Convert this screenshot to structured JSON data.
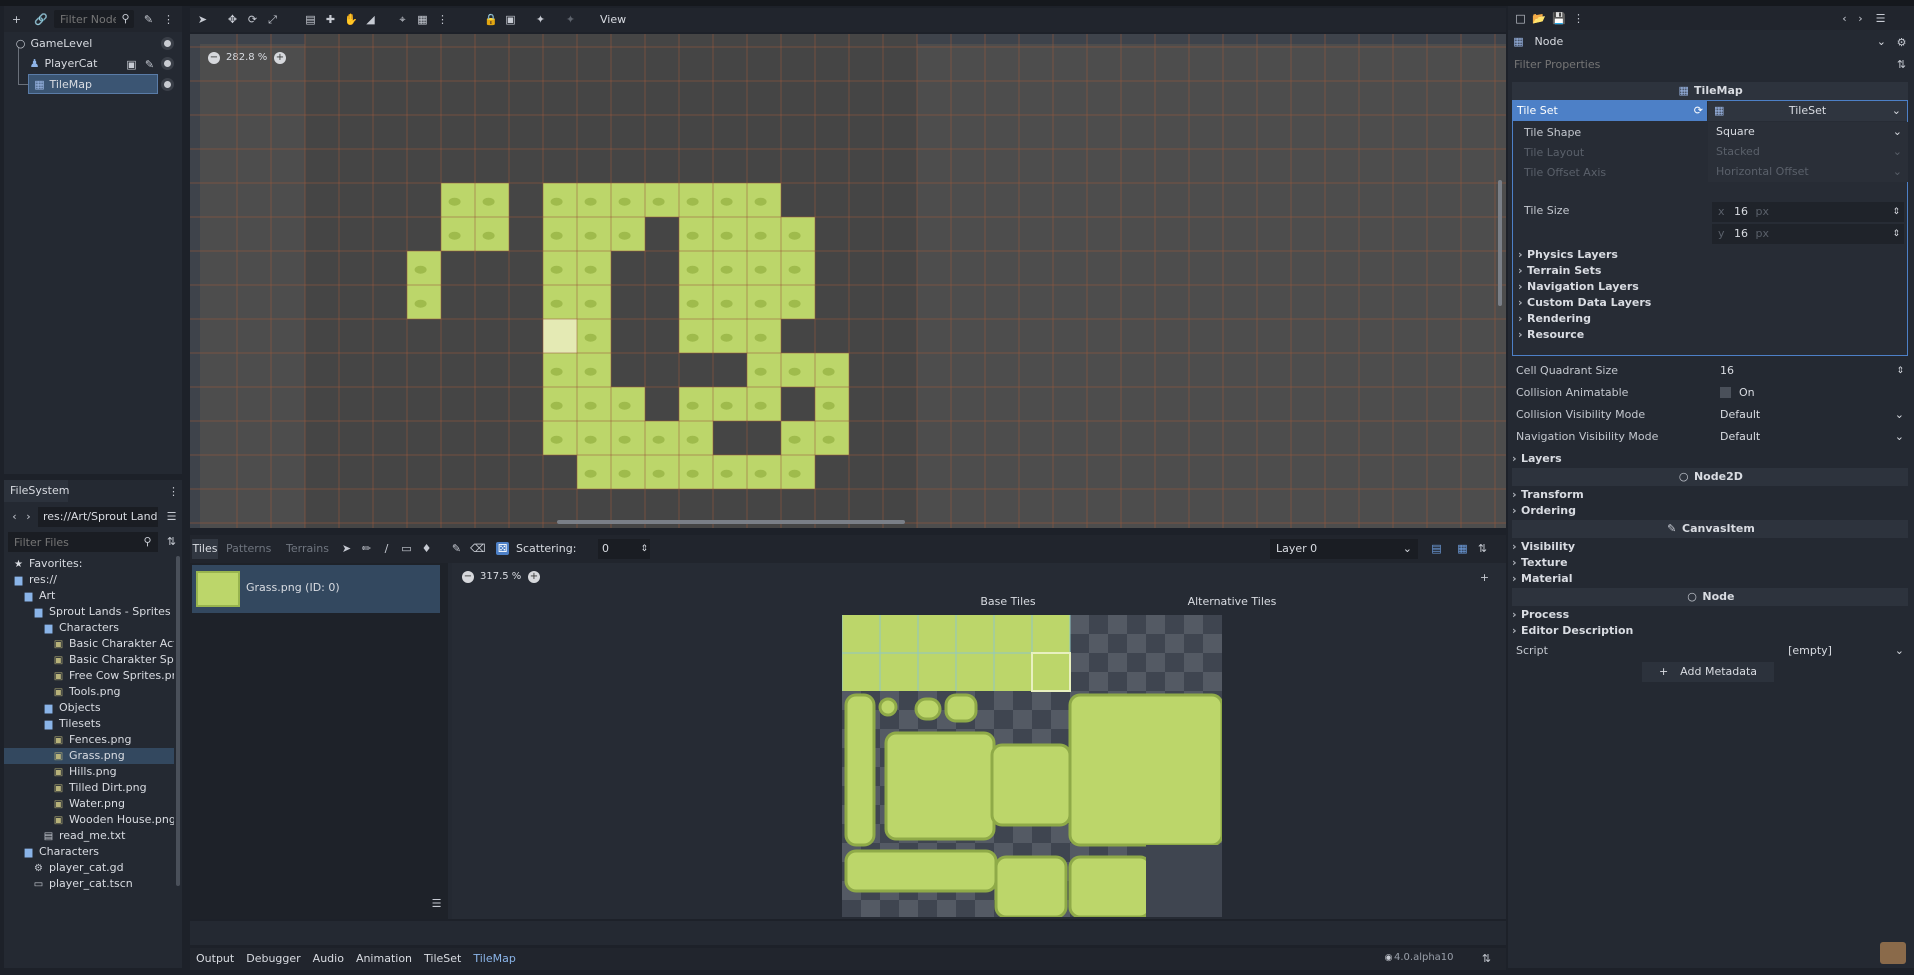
{
  "scene_dock": {
    "filter_placeholder": "Filter Node",
    "nodes": [
      {
        "label": "GameLevel",
        "icon": "node2d-icon"
      },
      {
        "label": "PlayerCat",
        "icon": "characterbody-icon"
      },
      {
        "label": "TileMap",
        "icon": "tilemap-icon"
      }
    ]
  },
  "filesystem": {
    "tab": "FileSystem",
    "path": "res://Art/Sprout Lands",
    "filter_placeholder": "Filter Files",
    "items": [
      {
        "label": "Favorites:",
        "depth": 0
      },
      {
        "label": "res://",
        "depth": 0
      },
      {
        "label": "Art",
        "depth": 1
      },
      {
        "label": "Sprout Lands - Sprites - Ba",
        "depth": 2
      },
      {
        "label": "Characters",
        "depth": 3
      },
      {
        "label": "Basic Charakter Action",
        "depth": 4
      },
      {
        "label": "Basic Charakter Sprite",
        "depth": 4
      },
      {
        "label": "Free Cow Sprites.png",
        "depth": 4
      },
      {
        "label": "Tools.png",
        "depth": 4
      },
      {
        "label": "Objects",
        "depth": 3
      },
      {
        "label": "Tilesets",
        "depth": 3
      },
      {
        "label": "Fences.png",
        "depth": 4
      },
      {
        "label": "Grass.png",
        "depth": 4
      },
      {
        "label": "Hills.png",
        "depth": 4
      },
      {
        "label": "Tilled Dirt.png",
        "depth": 4
      },
      {
        "label": "Water.png",
        "depth": 4
      },
      {
        "label": "Wooden House.png",
        "depth": 4
      },
      {
        "label": "read_me.txt",
        "depth": 3
      },
      {
        "label": "Characters",
        "depth": 1
      },
      {
        "label": "player_cat.gd",
        "depth": 2
      },
      {
        "label": "player_cat.tscn",
        "depth": 2
      }
    ]
  },
  "toolbar": {
    "view_label": "View"
  },
  "viewport": {
    "zoom": "282.8 %"
  },
  "tilemap_panel": {
    "tabs": [
      "Tiles",
      "Patterns",
      "Terrains"
    ],
    "scattering_label": "Scattering:",
    "scattering_value": "0",
    "layer": "Layer 0",
    "source_item": "Grass.png (ID: 0)",
    "atlas_zoom": "317.5 %",
    "base_tiles_label": "Base Tiles",
    "alt_tiles_label": "Alternative Tiles"
  },
  "bottom_bar": {
    "tabs": [
      "Output",
      "Debugger",
      "Audio",
      "Animation",
      "TileSet",
      "TileMap"
    ],
    "version": "4.0.alpha10"
  },
  "inspector": {
    "node": "Node",
    "filter_placeholder": "Filter Properties",
    "class_header": "TileMap",
    "tile_set_label": "Tile Set",
    "tile_set_value": "TileSet",
    "props": [
      {
        "key": "Tile Shape",
        "value": "Square",
        "dim": false
      },
      {
        "key": "Tile Layout",
        "value": "Stacked",
        "dim": true
      },
      {
        "key": "Tile Offset Axis",
        "value": "Horizontal Offset",
        "dim": true
      }
    ],
    "tile_size_label": "Tile Size",
    "tile_size_x": "16",
    "tile_size_y": "16",
    "px": "px",
    "sub_sections": [
      "Physics Layers",
      "Terrain Sets",
      "Navigation Layers",
      "Custom Data Layers",
      "Rendering",
      "Resource"
    ],
    "props2": [
      {
        "key": "Cell Quadrant Size",
        "value": "16"
      },
      {
        "key": "Collision Animatable",
        "value": "On"
      },
      {
        "key": "Collision Visibility Mode",
        "value": "Default"
      },
      {
        "key": "Navigation Visibility Mode",
        "value": "Default"
      }
    ],
    "layers": "Layers",
    "node2d": "Node2D",
    "transform": "Transform",
    "ordering": "Ordering",
    "canvasitem": "CanvasItem",
    "visibility": "Visibility",
    "texture": "Texture",
    "material": "Material",
    "process": "Process",
    "editor_description": "Editor Description",
    "script_key": "Script",
    "script_value": "[empty]",
    "add_metadata": "Add Metadata"
  },
  "colors": {
    "bg": "#1d2129",
    "panel": "#242932",
    "accent": "#4d80c7",
    "grass": "#bcd66a",
    "grid": "#b25e3c",
    "selected": "#3b5573"
  }
}
